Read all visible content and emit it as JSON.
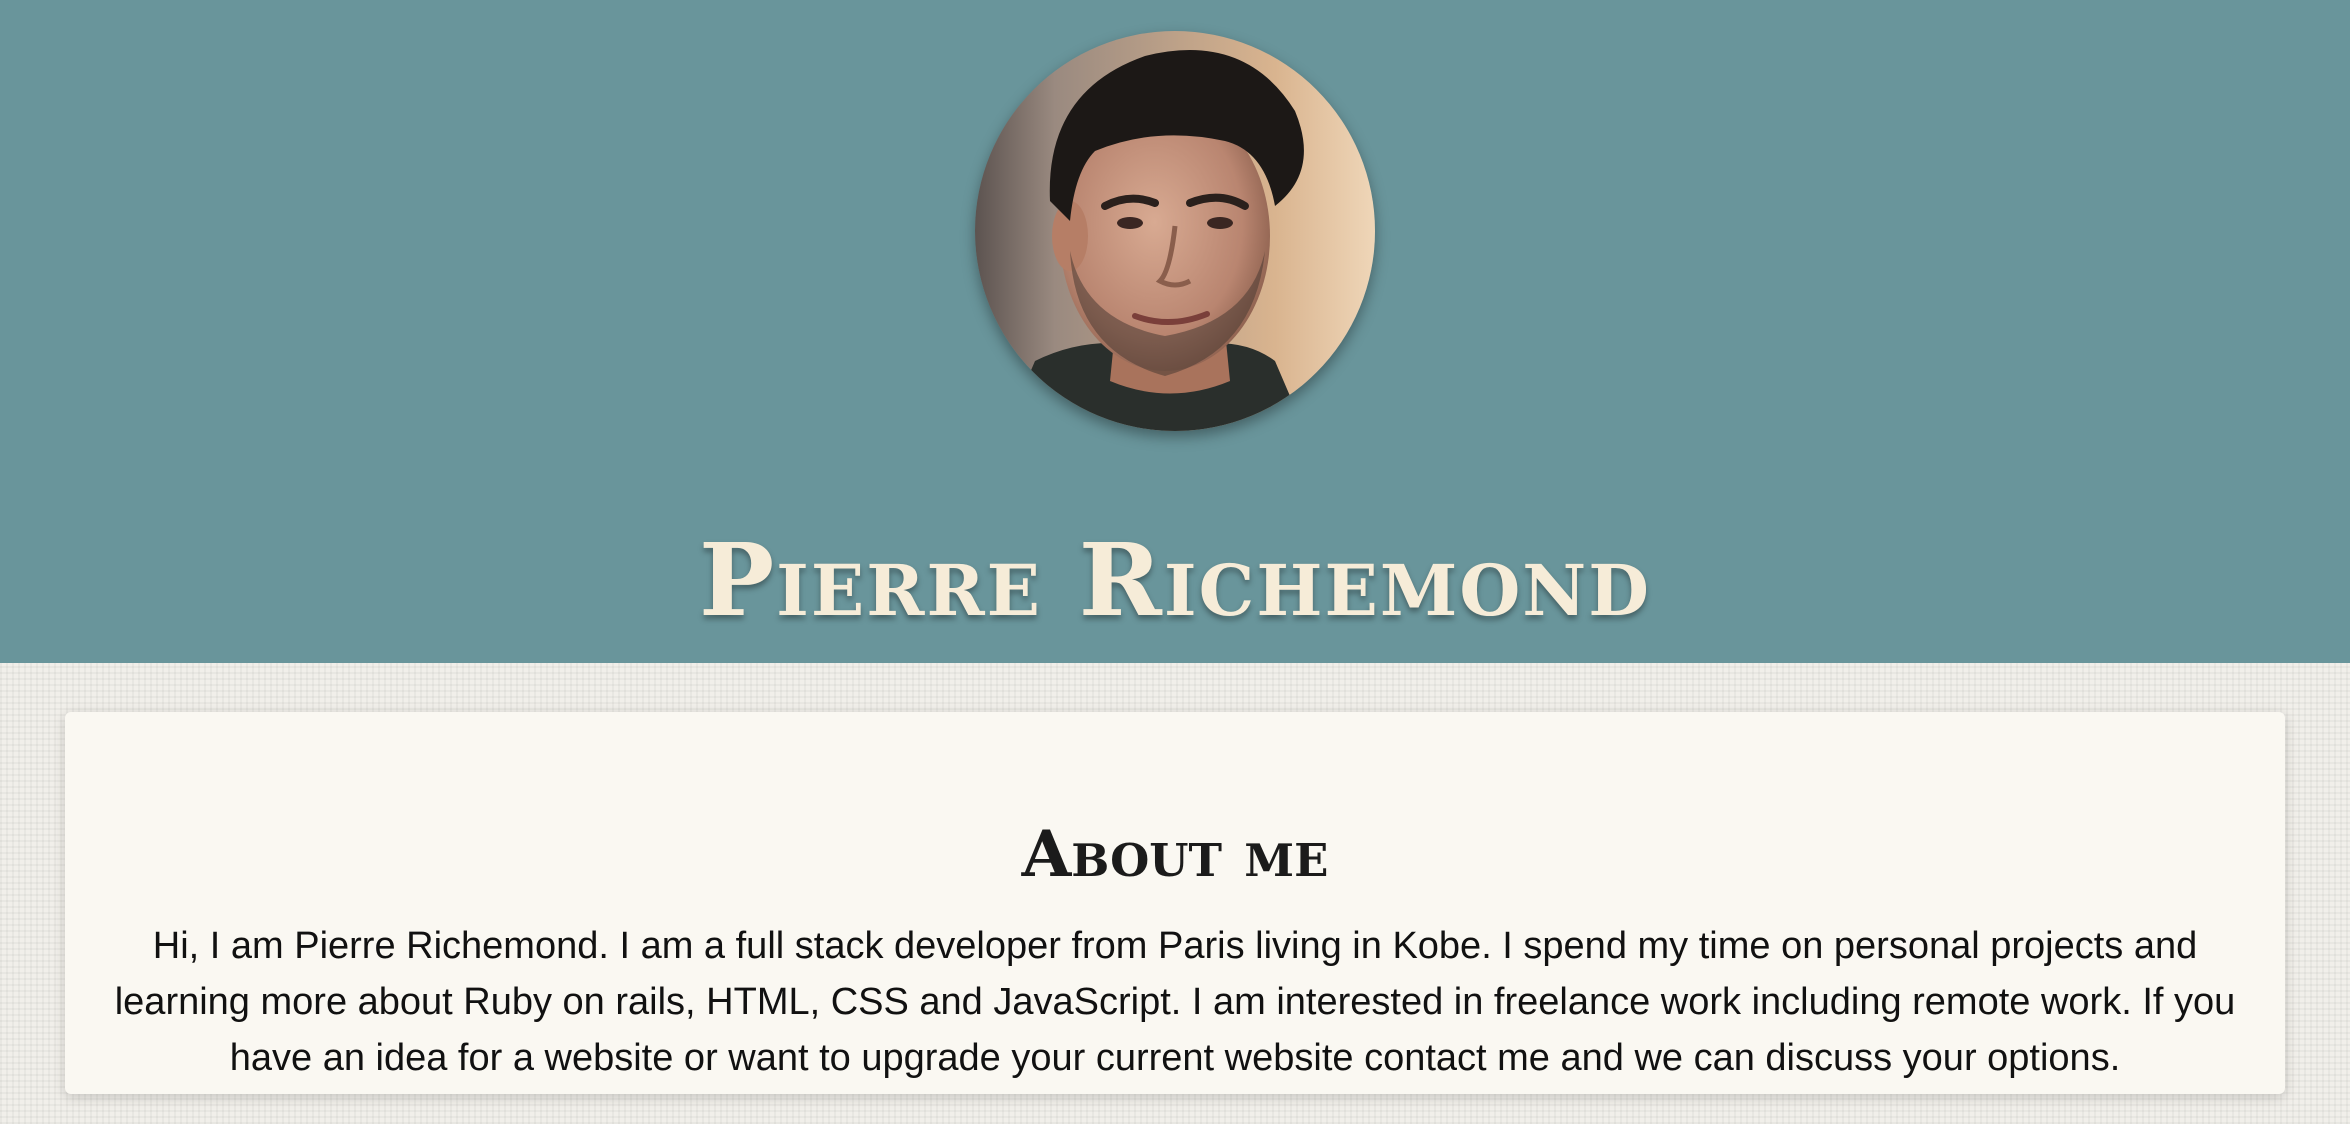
{
  "colors": {
    "hero_background": "#69959b",
    "name_text": "#f6ecd8",
    "card_background": "#faf8f2",
    "page_background": "#f1efea"
  },
  "header": {
    "avatar_alt": "Profile photo",
    "name": "Pierre Richemond"
  },
  "about": {
    "title": "About me",
    "body": "Hi, I am Pierre Richemond. I am a full stack developer from Paris living in Kobe. I spend my time on personal projects and learning more about Ruby on rails, HTML, CSS and JavaScript. I am interested in freelance work including remote work. If you have an idea for a website or want to upgrade your current website contact me and we can discuss your options."
  }
}
